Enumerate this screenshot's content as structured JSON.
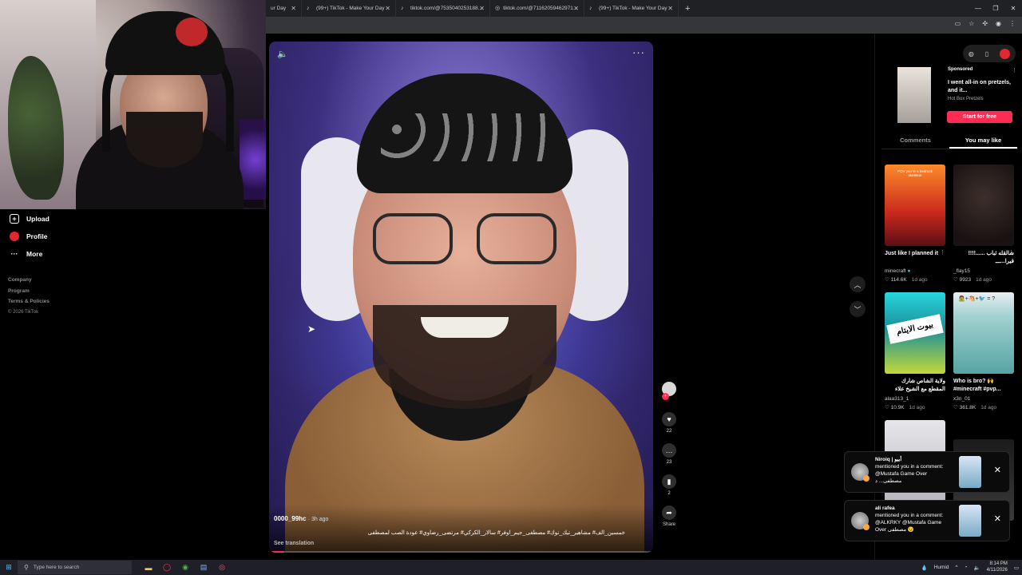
{
  "browser": {
    "tabs": [
      {
        "title": "ur Day"
      },
      {
        "title": "(99+) TikTok - Make Your Day"
      },
      {
        "title": "tiktok.com/@7535040253188..."
      },
      {
        "title": "tiktok.com/@71162059462971..."
      },
      {
        "title": "(99+) TikTok - Make Your Day"
      }
    ],
    "new_tab": "+",
    "window_controls": [
      "—",
      "❐",
      "✕"
    ]
  },
  "sidebar": {
    "items": [
      {
        "label": "Upload"
      },
      {
        "label": "Profile"
      },
      {
        "label": "More"
      }
    ],
    "footer": [
      "Company",
      "Program",
      "Terms & Policies"
    ],
    "copyright": "© 2026 TikTok"
  },
  "video": {
    "author": "0000_99hc",
    "ago": "3h ago",
    "caption": "خمسين_الف# مشاهير_تيك_توك# مصطفى_جيم_اوفر# سالار_الكركي# مرتضى_رضاوي# عودة الصب لمصطفى",
    "see_translation": "See translation",
    "progress": 0.04
  },
  "actions": {
    "likes": "22",
    "comments": "23",
    "saves": "2",
    "share": "Share"
  },
  "ad": {
    "sponsored": "Sponsored",
    "title": "I went all-in on pretzels, and it...",
    "brand": "Hot Box Pretzels",
    "cta": "Start for free"
  },
  "right_tabs": [
    {
      "label": "Comments",
      "active": false
    },
    {
      "label": "You may like",
      "active": true
    }
  ],
  "cards": [
    {
      "thumb_text": "POV you're a bedrock skeleton",
      "title": "Just like I planned it",
      "author": "minecraft",
      "likes": "114.6K",
      "ago": "1d ago"
    },
    {
      "thumb_text": "",
      "title": "شالقله ثباب ......!!!!قيرا...ـــ",
      "author": "_flay15",
      "likes": "9923",
      "ago": "1d ago"
    },
    {
      "thumb_text": "بيوت الايتام",
      "title": "ولاية الشاص شارك المقطع مع الشيخ علاء المهدي",
      "author": "alaa313_1",
      "likes": "10.9K",
      "ago": "1d ago"
    },
    {
      "thumb_text": "🧟+🐴+🐦 = ?",
      "title": "Who is bro? 🙌 #minecraft #pvp...",
      "author": "x3n_01",
      "likes": "361.8K",
      "ago": "1d ago"
    }
  ],
  "notifications": [
    {
      "name": "Niroiq | أبيو",
      "text": "mentioned you in a comment: @Mustafa Game Over مصطفى... د"
    },
    {
      "name": "ali rafea",
      "text": "mentioned you in a comment: @ALKRKY @Mustafa Game Over مصطفى 😉"
    }
  ],
  "taskbar": {
    "search_placeholder": "Type here to search",
    "weather": "Humid",
    "time": "8:14 PM",
    "date": "4/11/2026"
  },
  "colors": {
    "accent": "#fe2c55",
    "background": "#000000"
  }
}
